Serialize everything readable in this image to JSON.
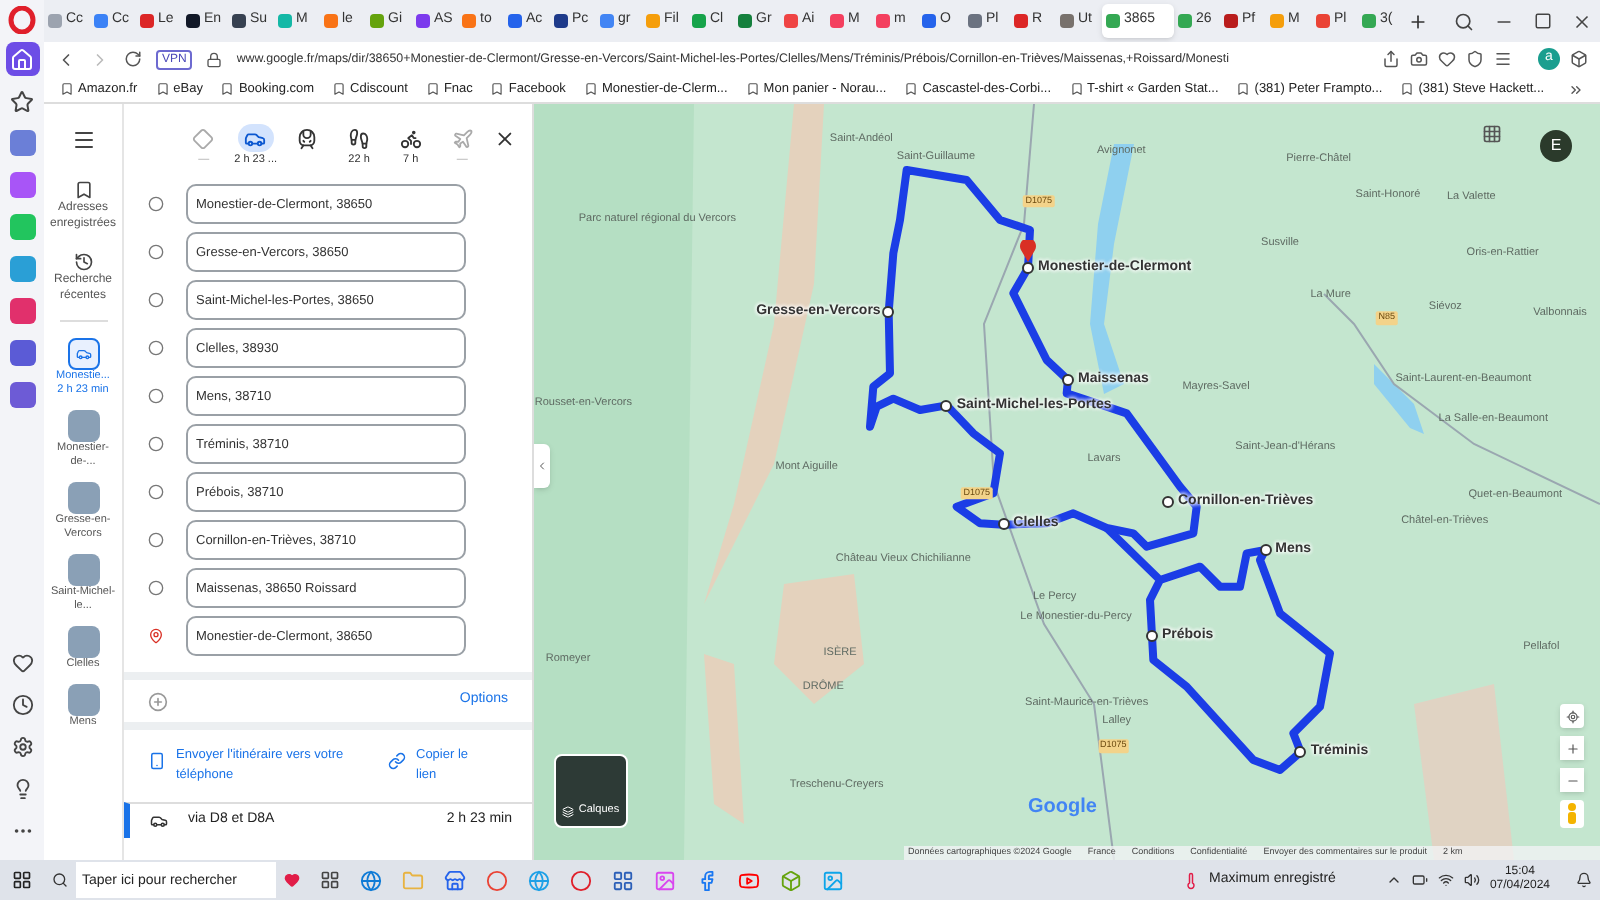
{
  "opera_sidebar": [
    {
      "kind": "home",
      "selected": true
    },
    {
      "kind": "star",
      "selected": false
    },
    {
      "kind": "app",
      "color": "#6b7fd7",
      "selected": false
    },
    {
      "kind": "app",
      "color": "#a855f7",
      "selected": false
    },
    {
      "kind": "app",
      "color": "#22c55e",
      "selected": false
    },
    {
      "kind": "app",
      "color": "#2a9fd6",
      "selected": false
    },
    {
      "kind": "app",
      "color": "#e1306c",
      "selected": false
    },
    {
      "kind": "app",
      "color": "#5b5bd6",
      "selected": false
    },
    {
      "kind": "app",
      "color": "#6d5bd6",
      "selected": false
    },
    {
      "kind": "heart",
      "selected": false
    },
    {
      "kind": "clock",
      "selected": false
    },
    {
      "kind": "settings",
      "selected": false
    },
    {
      "kind": "bulb",
      "selected": false
    },
    {
      "kind": "more",
      "selected": false
    }
  ],
  "tabs": [
    {
      "label": "Cc",
      "color": "#9ca3af",
      "selected": false
    },
    {
      "label": "Cc",
      "color": "#3b82f6",
      "selected": false
    },
    {
      "label": "Le",
      "color": "#dc2626",
      "selected": false
    },
    {
      "label": "En",
      "color": "#111827",
      "selected": false
    },
    {
      "label": "Su",
      "color": "#374151",
      "selected": false
    },
    {
      "label": "M",
      "color": "#14b8a6",
      "selected": false
    },
    {
      "label": "le",
      "color": "#f97316",
      "selected": false
    },
    {
      "label": "Gi",
      "color": "#65a30d",
      "selected": false
    },
    {
      "label": "AS",
      "color": "#7c3aed",
      "selected": false
    },
    {
      "label": "to",
      "color": "#f97316",
      "selected": false
    },
    {
      "label": "Ac",
      "color": "#2563eb",
      "selected": false
    },
    {
      "label": "Pc",
      "color": "#1e3a8a",
      "selected": false
    },
    {
      "label": "gr",
      "color": "#4285f4",
      "selected": false
    },
    {
      "label": "Fil",
      "color": "#f59e0b",
      "selected": false
    },
    {
      "label": "Cl",
      "color": "#16a34a",
      "selected": false
    },
    {
      "label": "Gr",
      "color": "#15803d",
      "selected": false
    },
    {
      "label": "Ai",
      "color": "#ef4444",
      "selected": false
    },
    {
      "label": "M",
      "color": "#f43f5e",
      "selected": false
    },
    {
      "label": "m",
      "color": "#f43f5e",
      "selected": false
    },
    {
      "label": "O",
      "color": "#2563eb",
      "selected": false
    },
    {
      "label": "Pl",
      "color": "#6b7280",
      "selected": false
    },
    {
      "label": "R",
      "color": "#dc2626",
      "selected": false
    },
    {
      "label": "Ut",
      "color": "#78716c",
      "selected": false
    },
    {
      "label": "3865",
      "color": "#34a853",
      "selected": true
    },
    {
      "label": "26",
      "color": "#34a853",
      "selected": false
    },
    {
      "label": "Pf",
      "color": "#b91c1c",
      "selected": false
    },
    {
      "label": "M",
      "color": "#f59e0b",
      "selected": false
    },
    {
      "label": "Pl",
      "color": "#ea4335",
      "selected": false
    },
    {
      "label": "3(",
      "color": "#34a853",
      "selected": false
    }
  ],
  "address_bar": {
    "vpn": "VPN",
    "url": "www.google.fr/maps/dir/38650+Monestier-de-Clermont/Gresse-en-Vercors/Saint-Michel-les-Portes/Clelles/Mens/Tréminis/Prébois/Cornillon-en-Trièves/Maissenas,+Roissard/Monesti",
    "profile": "a"
  },
  "bookmarks": [
    "Amazon.fr",
    "eBay",
    "Booking.com",
    "Cdiscount",
    "Fnac",
    "Facebook",
    "Monestier-de-Clerm...",
    "Mon panier - Norau...",
    "Cascastel-des-Corbi...",
    "T-shirt « Garden Stat...",
    "(381) Peter Frampto...",
    "(381) Steve Hackett..."
  ],
  "maps_rail": {
    "saved": "Adresses enregistrées",
    "recent": "Recherche récentes",
    "items": [
      {
        "kind": "route",
        "label": "Monestie...",
        "sublabel": "2 h 23 min",
        "selected": true
      },
      {
        "kind": "place",
        "label": "Monestier-de-...",
        "selected": false
      },
      {
        "kind": "place",
        "label": "Gresse-en-Vercors",
        "selected": false
      },
      {
        "kind": "place",
        "label": "Saint-Michel-le...",
        "selected": false
      },
      {
        "kind": "place",
        "label": "Clelles",
        "selected": false
      },
      {
        "kind": "place",
        "label": "Mens",
        "selected": false
      }
    ]
  },
  "modes": [
    {
      "kind": "best",
      "label": "—",
      "selected": false
    },
    {
      "kind": "car",
      "label": "2 h 23 ...",
      "selected": true
    },
    {
      "kind": "transit",
      "selected": false
    },
    {
      "kind": "walk",
      "label": "22 h",
      "selected": false
    },
    {
      "kind": "bike",
      "label": "7 h",
      "selected": false
    },
    {
      "kind": "plane",
      "label": "—",
      "selected": false
    }
  ],
  "stops": [
    {
      "kind": "waypoint",
      "value": "Monestier-de-Clermont, 38650"
    },
    {
      "kind": "waypoint",
      "value": "Gresse-en-Vercors, 38650"
    },
    {
      "kind": "waypoint",
      "value": "Saint-Michel-les-Portes, 38650"
    },
    {
      "kind": "waypoint",
      "value": "Clelles, 38930"
    },
    {
      "kind": "waypoint",
      "value": "Mens, 38710"
    },
    {
      "kind": "waypoint",
      "value": "Tréminis, 38710"
    },
    {
      "kind": "waypoint",
      "value": "Prébois, 38710"
    },
    {
      "kind": "waypoint",
      "value": "Cornillon-en-Trièves, 38710"
    },
    {
      "kind": "waypoint",
      "value": "Maissenas, 38650 Roissard"
    },
    {
      "kind": "destination",
      "value": "Monestier-de-Clermont, 38650"
    }
  ],
  "options": "Options",
  "send_to_phone": "Envoyer l'itinéraire vers votre téléphone",
  "copy_link": "Copier le lien",
  "route": {
    "via": "via D8 et D8A",
    "duration": "2 h 23 min"
  },
  "map": {
    "stops": [
      "Monestier-de-Clermont",
      "Gresse-en-Vercors",
      "Maissenas",
      "Saint-Michel-les-Portes",
      "Cornillon-en-Trièves",
      "Clelles",
      "Mens",
      "Prébois",
      "Tréminis"
    ],
    "places": [
      "Saint-Andéol",
      "Saint-Guillaume",
      "Avignonet",
      "Pierre-Châtel",
      "Saint-Honoré",
      "La Valette",
      "Susville",
      "Oris-en-Rattier",
      "Parc naturel régional du Vercors",
      "La Mure",
      "Siévoz",
      "Valbonnais",
      "Mayres-Savel",
      "Saint-Laurent-en-Beaumont",
      "La Salle-en-Beaumont",
      "Saint-Jean-d'Hérans",
      "Lavars",
      "Mont Aiguille",
      "Quet-en-Beaumont",
      "Châtel-en-Trièves",
      "Rousset-en-Vercors",
      "Château Vieux Chichilianne",
      "Le Percy",
      "Le Monestier-du-Percy",
      "Pellafol",
      "Romeyer",
      "ISÈRE",
      "DRÔME",
      "Saint-Maurice-en-Trièves",
      "Lalley",
      "Treschenu-Creyers"
    ],
    "roads": [
      "D1075",
      "D1075",
      "N85",
      "D1075"
    ],
    "avatar": "E",
    "layers": "Calques",
    "logo": "Google",
    "attribution": [
      "Données cartographiques ©2024 Google",
      "France",
      "Conditions",
      "Confidentialité",
      "Envoyer des commentaires sur le produit",
      "2 km"
    ]
  },
  "taskbar": {
    "search_placeholder": "Taper ici pour rechercher",
    "status": "Maximum enregistré",
    "time": "15:04",
    "date": "07/04/2024"
  }
}
